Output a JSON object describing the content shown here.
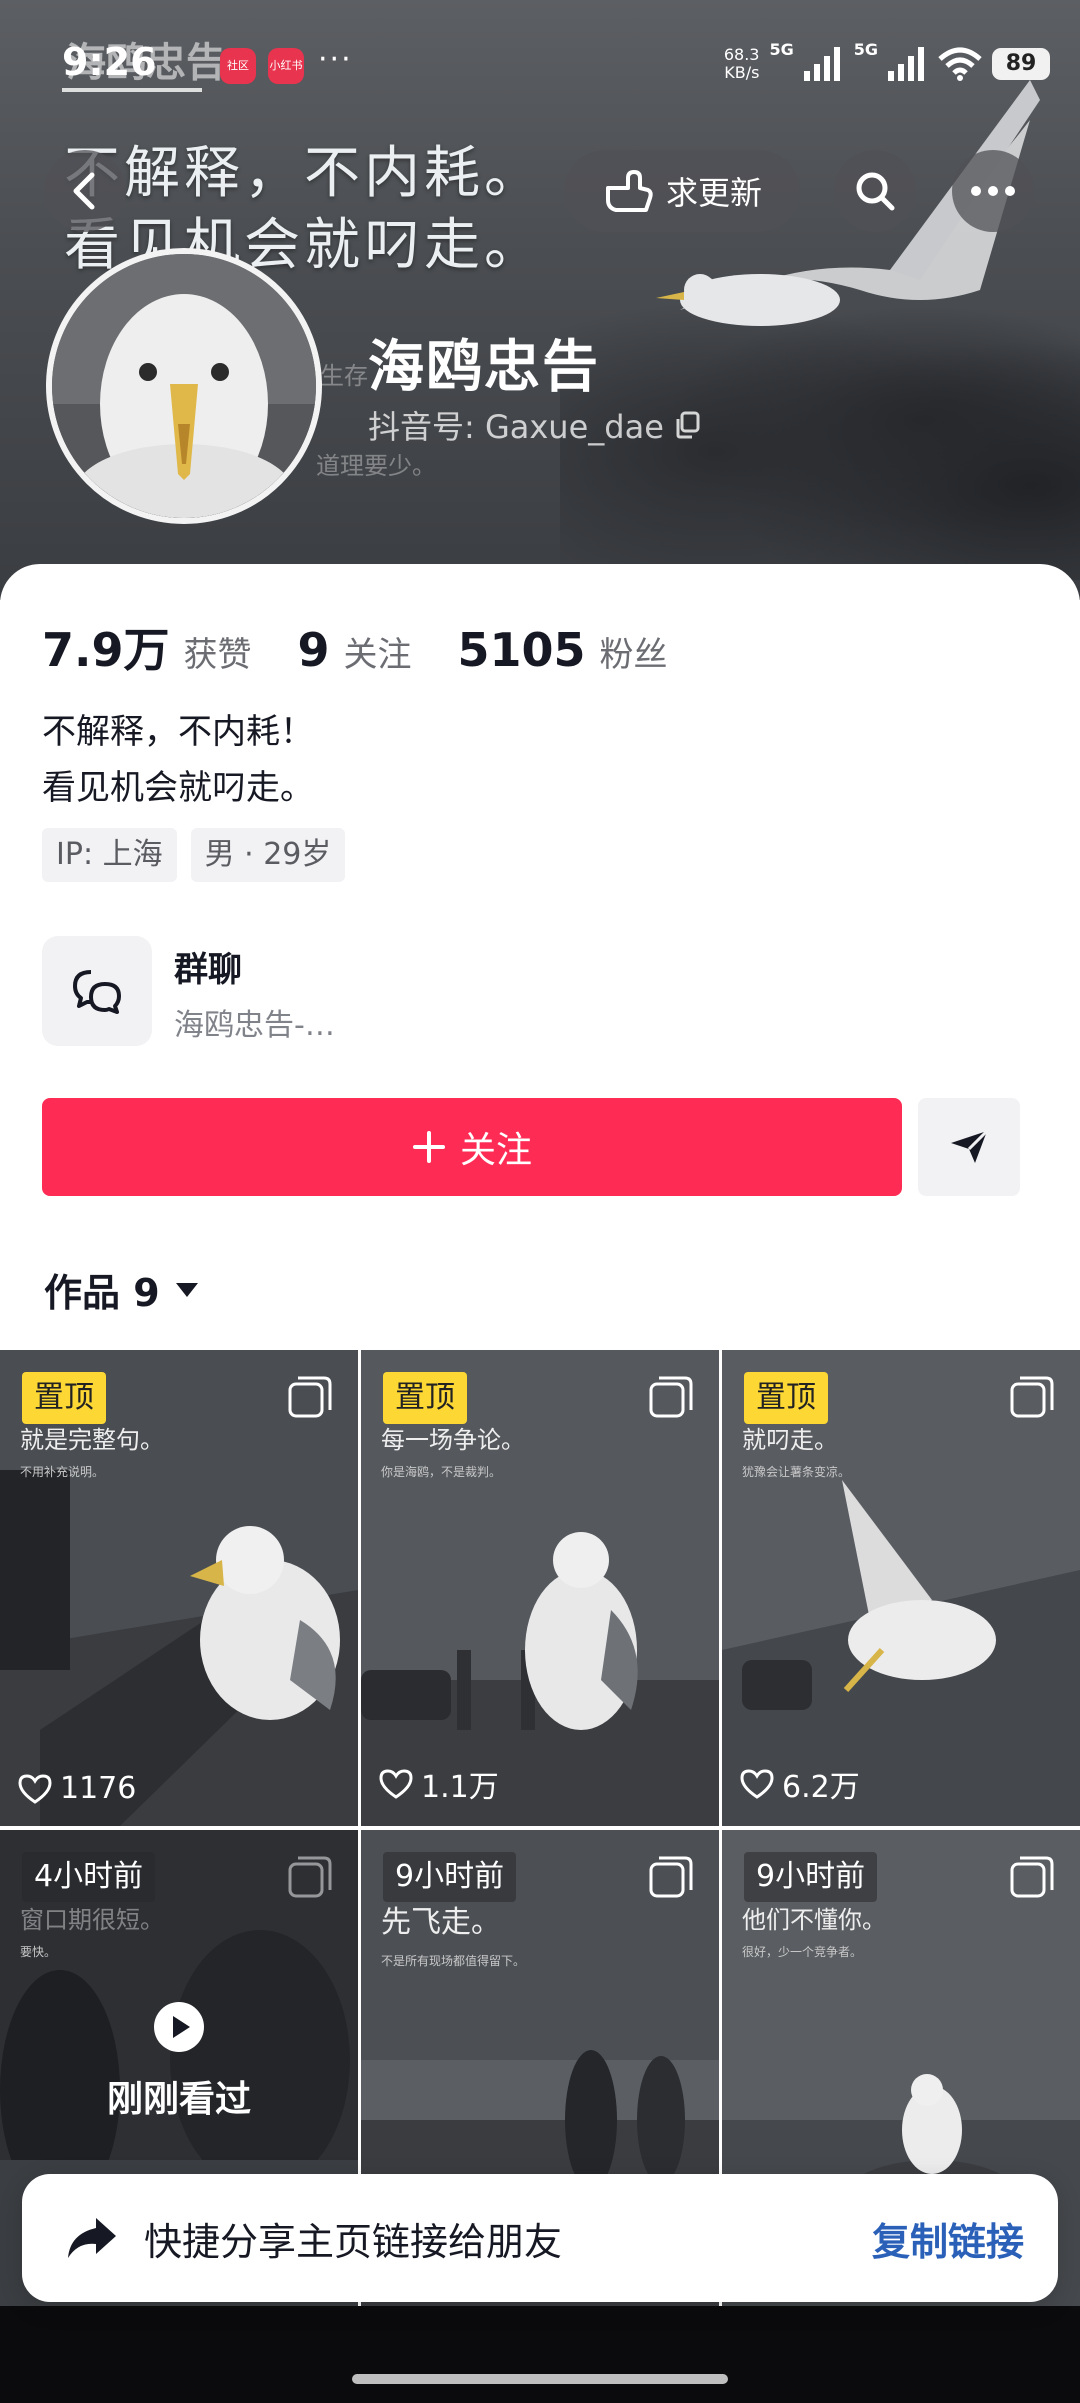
{
  "status_bar": {
    "time": "9:26",
    "overlay_title": "海鸥忠告",
    "app_badge_1": "社区",
    "app_badge_2": "小红书",
    "dots": "···",
    "net_speed": "68.3",
    "net_unit": "KB/s",
    "sig1": "5G",
    "sig2": "5G",
    "battery": "89"
  },
  "banner": {
    "slogan_line1": "不解释，不内耗。",
    "slogan_line2": "看见机会就叼走。",
    "update_label": "求更新",
    "ghost_1": "生存",
    "ghost_2": "道理要少。"
  },
  "profile": {
    "name": "海鸥忠告",
    "douyin_id": "抖音号: Gaxue_dae"
  },
  "stats": [
    {
      "value": "7.9万",
      "label": "获赞"
    },
    {
      "value": "9",
      "label": "关注"
    },
    {
      "value": "5105",
      "label": "粉丝"
    }
  ],
  "bio": {
    "line1": "不解释，不内耗！",
    "line2": "看见机会就叼走。"
  },
  "tags": [
    "IP: 上海",
    "男 · 29岁"
  ],
  "group_chat": {
    "title": "群聊",
    "subtitle": "海鸥忠告-…"
  },
  "actions": {
    "follow_label": "关注"
  },
  "works_tab": {
    "label": "作品 9"
  },
  "tiles": [
    {
      "pin": "置顶",
      "caption": "就是完整句。",
      "caption_small": "不用补充说明。",
      "likes": "1176"
    },
    {
      "pin": "置顶",
      "caption": "每一场争论。",
      "caption_small": "你是海鸥，不是裁判。",
      "likes": "1.1万"
    },
    {
      "pin": "置顶",
      "caption": "就叼走。",
      "caption_small": "犹豫会让薯条变凉。",
      "likes": "6.2万"
    },
    {
      "time": "4小时前",
      "caption": "窗口期很短。",
      "caption_small": "要快。",
      "watched": "刚刚看过"
    },
    {
      "time": "9小时前",
      "caption": "先飞走。",
      "caption_small": "不是所有现场都值得留下。"
    },
    {
      "time": "9小时前",
      "caption": "他们不懂你。",
      "caption_small": "很好，少一个竞争者。"
    }
  ],
  "share_bar": {
    "text": "快捷分享主页链接给朋友",
    "copy": "复制链接"
  },
  "colors": {
    "follow": "#fe2c55",
    "pin": "#fdd835",
    "link": "#2a60b8"
  }
}
